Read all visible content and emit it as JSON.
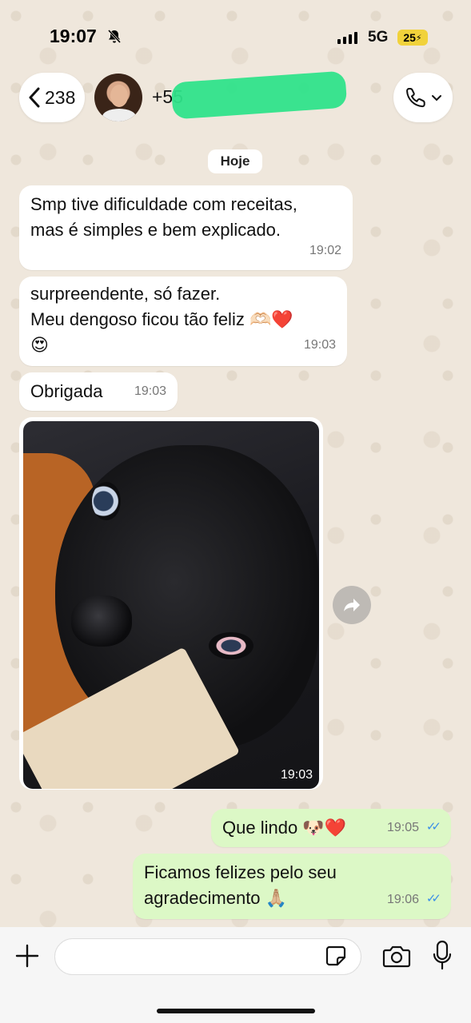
{
  "status_bar": {
    "time": "19:07",
    "network": "5G",
    "battery": "25",
    "icons": [
      "bell-off-icon",
      "signal-icon",
      "battery-charging-icon"
    ]
  },
  "header": {
    "back_count": "238",
    "contact_name": "+55",
    "icons": [
      "chevron-left-icon",
      "phone-icon",
      "chevron-down-icon"
    ]
  },
  "date_chip": "Hoje",
  "messages": [
    {
      "direction": "in",
      "text": "Smp tive dificuldade com receitas,\nmas é simples e bem explicado.",
      "time": "19:02"
    },
    {
      "direction": "in",
      "text": "surpreendente, só fazer.\nMeu dengoso ficou tão feliz 🫶🏻❤️\n😍",
      "time": "19:03"
    },
    {
      "direction": "in",
      "text": "Obrigada",
      "time": "19:03"
    },
    {
      "direction": "in",
      "type": "image",
      "time": "19:03"
    },
    {
      "direction": "out",
      "text": "Que lindo 🐶❤️",
      "time": "19:05",
      "status": "read"
    },
    {
      "direction": "out",
      "text": "Ficamos felizes pelo seu\nagradecimento 🙏🏼",
      "time": "19:06",
      "status": "read"
    }
  ],
  "composer": {
    "placeholder": "",
    "icons": [
      "plus-icon",
      "sticker-icon",
      "camera-icon",
      "microphone-icon"
    ]
  },
  "colors": {
    "incoming_bubble": "#ffffff",
    "outgoing_bubble": "#dcf8c6",
    "read_ticks": "#3b8fe8",
    "wallpaper": "#efe7dc",
    "battery": "#f1d23b"
  }
}
